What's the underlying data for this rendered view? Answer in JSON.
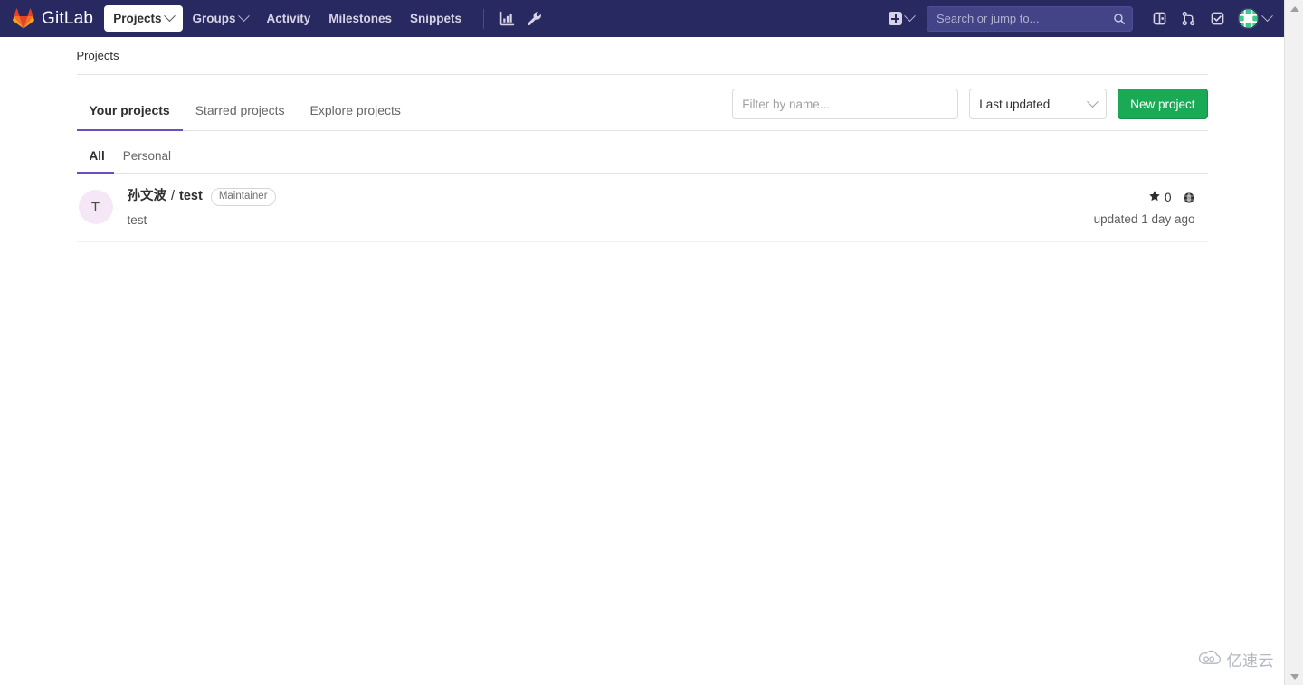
{
  "navbar": {
    "brand": "GitLab",
    "brand_icon": "gitlab-tanuki-logo",
    "items": [
      {
        "label": "Projects",
        "icon": "chevron-down-icon",
        "has_caret": true,
        "active": true
      },
      {
        "label": "Groups",
        "icon": "chevron-down-icon",
        "has_caret": true,
        "active": false
      },
      {
        "label": "Activity",
        "has_caret": false,
        "active": false
      },
      {
        "label": "Milestones",
        "has_caret": false,
        "active": false
      },
      {
        "label": "Snippets",
        "has_caret": false,
        "active": false
      }
    ],
    "analytics_icon": "chart-analytics-icon",
    "admin_icon": "wrench-icon",
    "create_new": {
      "icon": "plus-square-icon",
      "caret": "chevron-down-icon"
    },
    "search": {
      "placeholder": "Search or jump to...",
      "value": "",
      "icon": "search-icon"
    },
    "right_icons": [
      {
        "name": "issues-icon"
      },
      {
        "name": "merge-request-icon"
      },
      {
        "name": "todos-done-icon"
      }
    ],
    "avatar": {
      "name": "user-avatar",
      "caret": "chevron-down-icon"
    },
    "colors": {
      "background": "#292961",
      "search_bg": "#434388"
    }
  },
  "breadcrumb": {
    "label": "Projects"
  },
  "tabs": [
    {
      "label": "Your projects",
      "active": true
    },
    {
      "label": "Starred projects",
      "active": false
    },
    {
      "label": "Explore projects",
      "active": false
    }
  ],
  "toolbar": {
    "filter": {
      "placeholder": "Filter by name...",
      "value": ""
    },
    "sort": {
      "value": "Last updated",
      "caret": "chevron-down-icon"
    },
    "new_project_label": "New project",
    "new_project_color": "#1aaa55"
  },
  "subtabs": [
    {
      "label": "All",
      "active": true
    },
    {
      "label": "Personal",
      "active": false
    }
  ],
  "projects": [
    {
      "avatar_letter": "T",
      "avatar_color": "#f6e7f6",
      "namespace": "孙文波",
      "separator": "/",
      "name": "test",
      "role_badge": "Maintainer",
      "description": "test",
      "stars": "0",
      "star_icon": "star-icon",
      "visibility_icon": "globe-public-icon",
      "updated": "updated 1 day ago"
    }
  ],
  "watermark": {
    "text": "亿速云",
    "icon": "cloud-icon"
  },
  "accent": {
    "tab_underline": "#6b4fbb",
    "link": "#2e2e2e"
  }
}
